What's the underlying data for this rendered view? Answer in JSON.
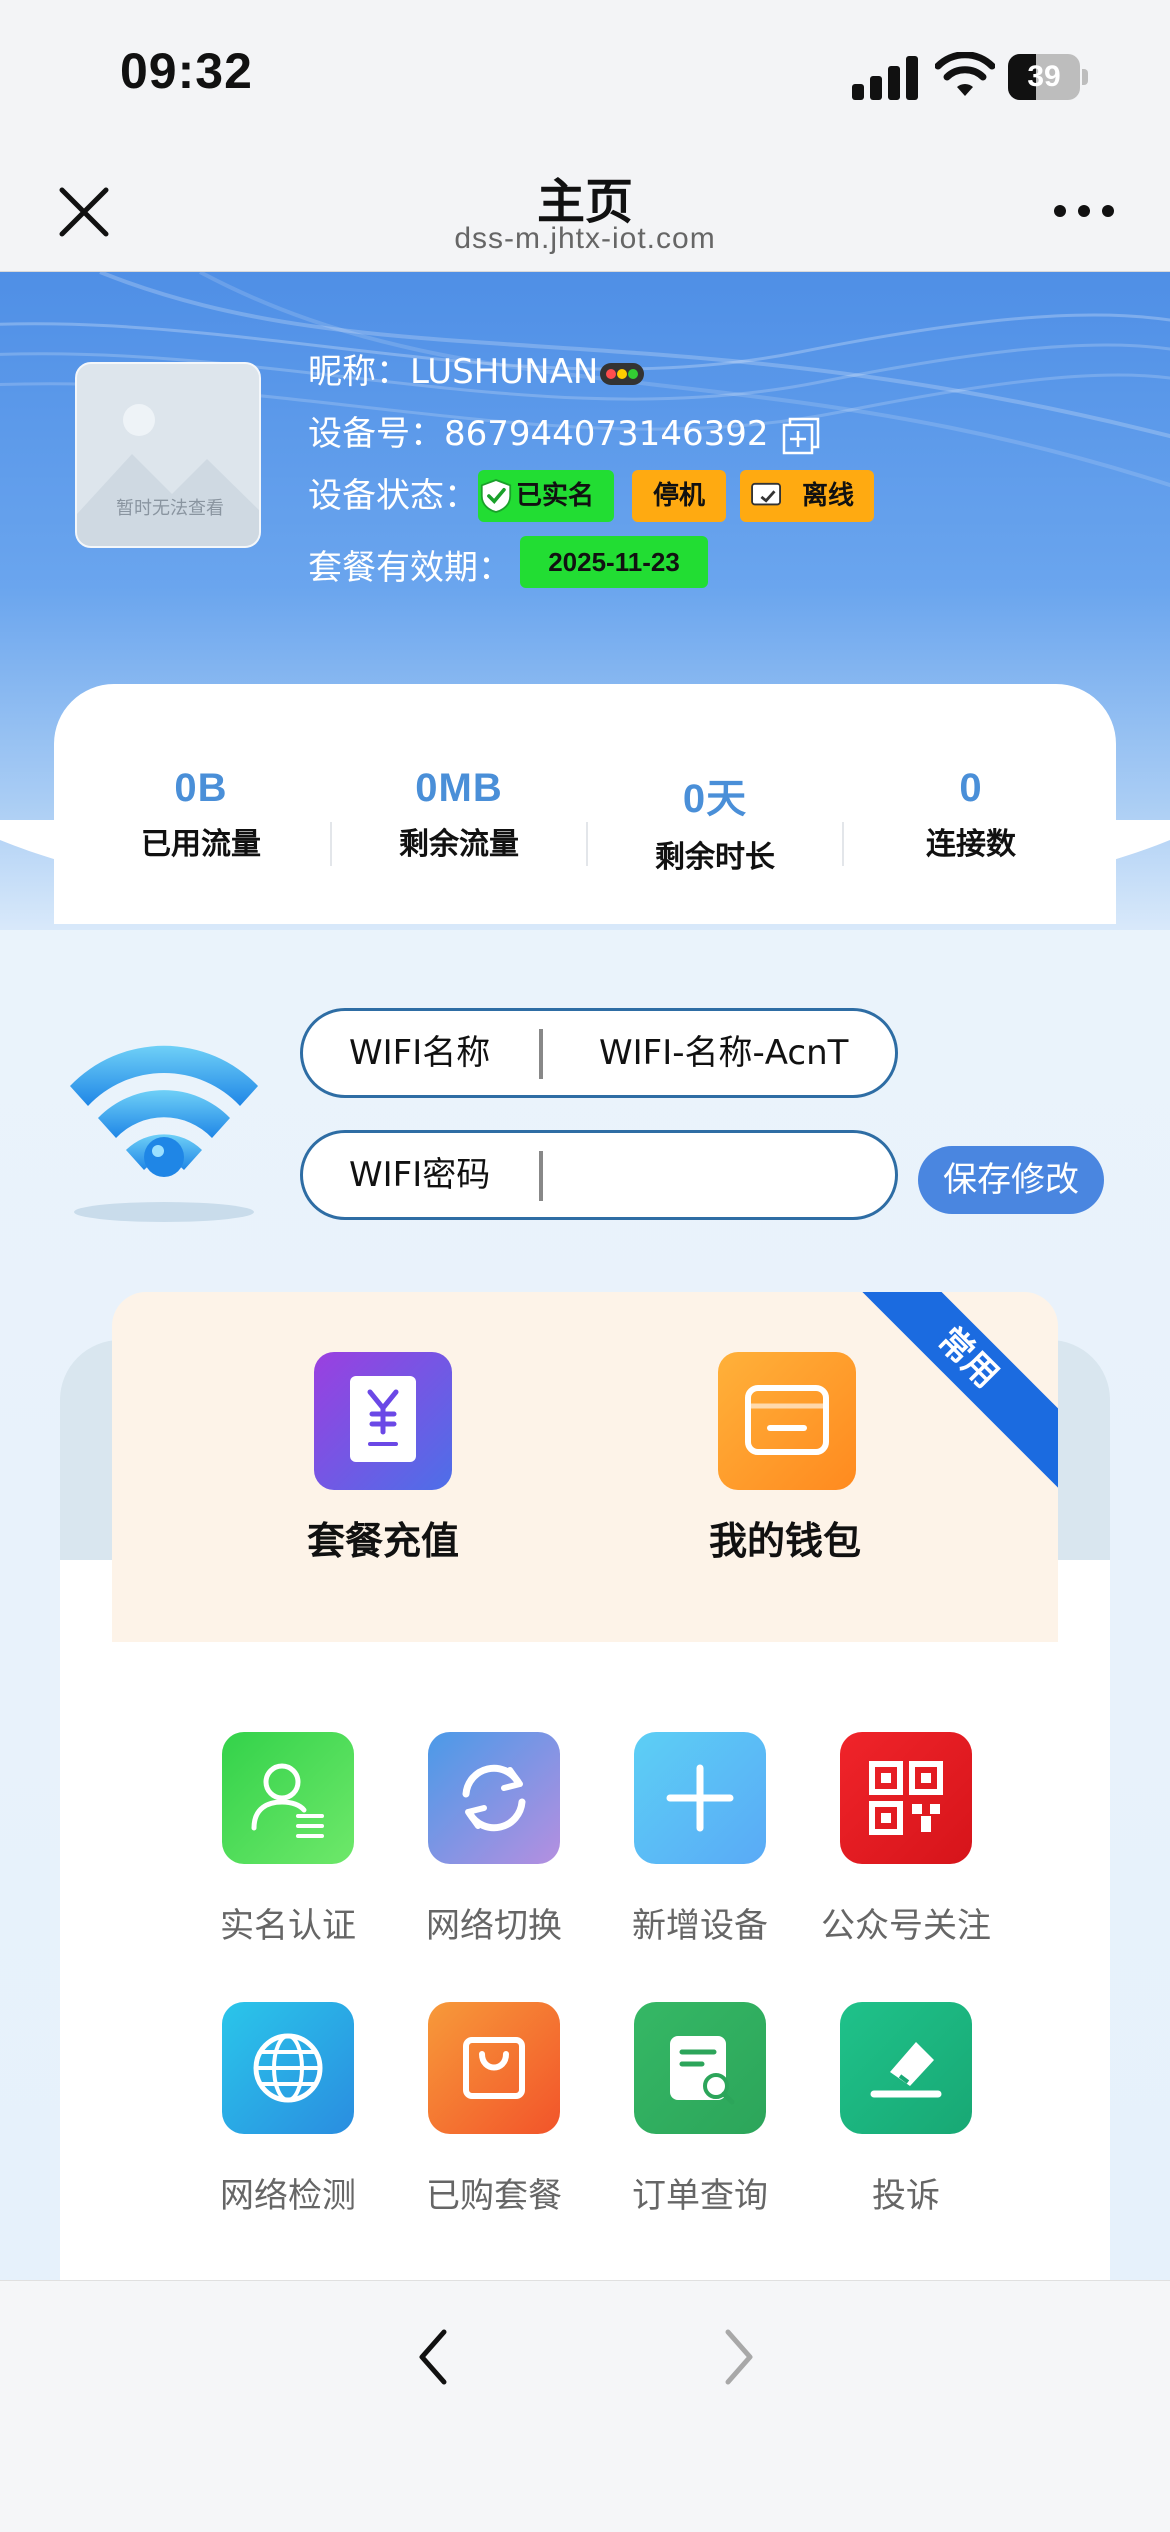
{
  "status_bar": {
    "time": "09:32",
    "battery": "39",
    "battery_level": 0.39
  },
  "header": {
    "title": "主页",
    "url": "dss-m.jhtx-iot.com"
  },
  "profile": {
    "avatar_text": "暂时无法查看",
    "nickname_label": "昵称：",
    "nickname": "LUSHUNAN",
    "device_label": "设备号：",
    "device_id": "867944073146392",
    "status_label": "设备状态：",
    "badges": [
      "已实名",
      "停机",
      "离线"
    ],
    "expiry_label": "套餐有效期：",
    "expiry_date": "2025-11-23"
  },
  "stats": [
    {
      "value": "0B",
      "label": "已用流量"
    },
    {
      "value": "0MB",
      "label": "剩余流量"
    },
    {
      "value": "0天",
      "label": "剩余时长"
    },
    {
      "value": "0",
      "label": "连接数"
    }
  ],
  "wifi": {
    "name_label": "WIFI名称",
    "name_value": "WIFI-名称-AcnT",
    "password_label": "WIFI密码",
    "password_value": "",
    "save_label": "保存修改"
  },
  "quick": {
    "ribbon": "常用",
    "items": [
      {
        "label": "套餐充值",
        "icon": "yuan-document-icon"
      },
      {
        "label": "我的钱包",
        "icon": "wallet-icon"
      }
    ]
  },
  "grid": [
    {
      "label": "实名认证",
      "icon": "user-verify-icon"
    },
    {
      "label": "网络切换",
      "icon": "refresh-icon"
    },
    {
      "label": "新增设备",
      "icon": "plus-icon"
    },
    {
      "label": "公众号关注",
      "icon": "qr-code-icon"
    },
    {
      "label": "网络检测",
      "icon": "globe-icon"
    },
    {
      "label": "已购套餐",
      "icon": "shopping-bag-icon"
    },
    {
      "label": "订单查询",
      "icon": "order-search-icon"
    },
    {
      "label": "投诉",
      "icon": "complaint-icon"
    }
  ],
  "colors": {
    "accent": "#4a86e0",
    "stat_value": "#4a8fd8",
    "badge_green": "#22dd33",
    "badge_orange": "#ffaa11",
    "ribbon": "#1b6be0"
  }
}
